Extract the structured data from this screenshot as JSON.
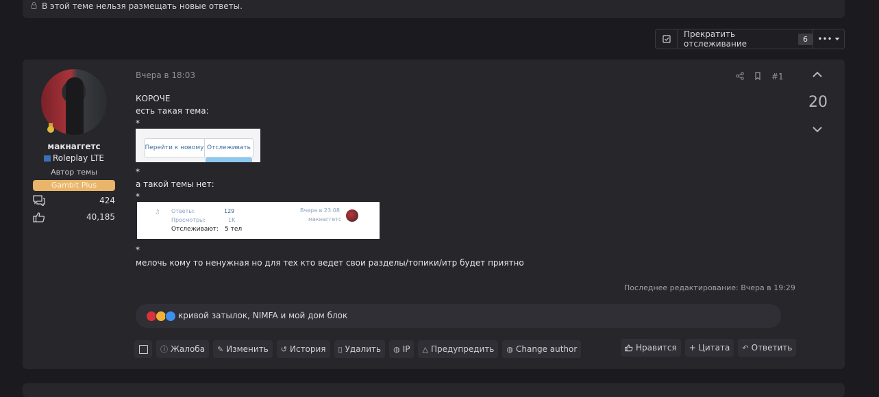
{
  "closed_notice": {
    "icon": "lock-icon",
    "text": "В этой теме нельзя размещать новые ответы."
  },
  "watch": {
    "checkbox_icon": "checkbox-icon",
    "label": "Прекратить отслеживание",
    "count": "6",
    "more_label": "•••",
    "more_icon": "caret-down-icon"
  },
  "post": {
    "author": {
      "username": "макнаггетс",
      "group": "Roleplay LTE",
      "role": "Автор темы",
      "badge": "Gambit Plus",
      "badge_color": "#e8b56a",
      "messages": "424",
      "likes": "40,185"
    },
    "date": "Вчера в 18:03",
    "number": "#1",
    "score": "20",
    "content": {
      "line1": "КОРОЧЕ",
      "line2": "есть такая тема:",
      "star": "*",
      "image1": {
        "btn1": "Перейти к новому",
        "btn2": "Отслеживать"
      },
      "line3": "а такой темы нет:",
      "image2": {
        "replies_label": "Ответы:",
        "replies_value": "129",
        "views_label": "Просмотры:",
        "views_value": "1K",
        "watchers_label": "Отслеживают:",
        "watchers_value": "5 тел",
        "last_date": "Вчера в 23:08",
        "last_user": "макнаггетс"
      },
      "line4": "мелочь кому то ненужная но для тех кто ведет свои разделы/топики/итр будет приятно"
    },
    "edited": "Последнее редактирование: Вчера в 19:29",
    "reactions_text": "кривой затылок, NIMFA и мой дом блок",
    "actions_left": {
      "report": "Жалоба",
      "edit": "Изменить",
      "history": "История",
      "delete": "Удалить",
      "ip": "IP",
      "warn": "Предупредить",
      "change_author": "Change author"
    },
    "actions_right": {
      "like": "Нравится",
      "quote": "+ Цитата",
      "reply": "Ответить"
    }
  },
  "colors": {
    "background": "#1b1b1f",
    "card": "#26262b",
    "accent_badge": "#e8b56a"
  }
}
